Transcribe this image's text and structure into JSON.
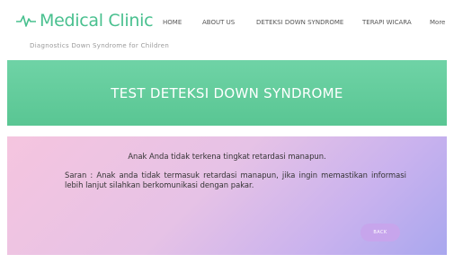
{
  "brand": {
    "name": "Medical Clinic",
    "tagline": "Diagnostics Down Syndrome for Children",
    "accent_color": "#49c08f",
    "logo_icon": "heartbeat-icon"
  },
  "nav": {
    "items": [
      "HOME",
      "ABOUT US",
      "DETEKSI DOWN SYNDROME",
      "TERAPI WICARA",
      "More"
    ]
  },
  "banner": {
    "title": "TEST DETEKSI DOWN SYNDROME",
    "color": "#5ccb99"
  },
  "result": {
    "message": "Anak Anda tidak terkena tingkat retardasi manapun.",
    "advice": "Saran : Anak anda tidak termasuk retardasi manapun, jika ingin memastikan informasi lebih lanjut silahkan berkomunikasi dengan pakar."
  },
  "back_button": {
    "label": "BACK",
    "color": "#c7a5ec"
  }
}
